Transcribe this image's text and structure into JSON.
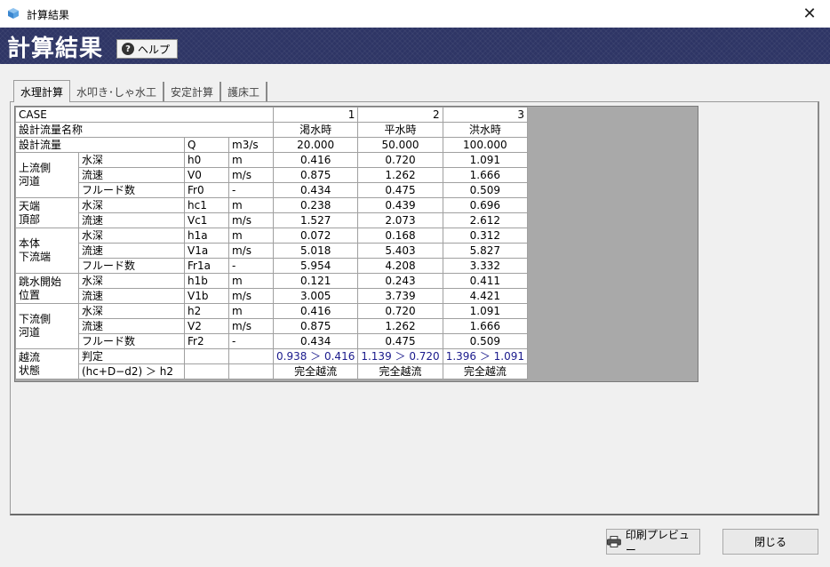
{
  "window": {
    "title": "計算結果",
    "close_glyph": "✕"
  },
  "header": {
    "title": "計算結果",
    "help_label": "ヘルプ"
  },
  "tabs": [
    {
      "label": "水理計算",
      "active": true
    },
    {
      "label": "水叩き･しゃ水工",
      "active": false
    },
    {
      "label": "安定計算",
      "active": false
    },
    {
      "label": "護床工",
      "active": false
    }
  ],
  "table": {
    "case_label": "CASE",
    "cases": [
      "1",
      "2",
      "3"
    ],
    "name_label": "設計流量名称",
    "names": [
      "渇水時",
      "平水時",
      "洪水時"
    ],
    "flow": {
      "label": "設計流量",
      "sym": "Q",
      "unit": "m3/s",
      "values": [
        "20.000",
        "50.000",
        "100.000"
      ]
    },
    "groups": [
      {
        "label": "上流側\n河道",
        "rows": [
          {
            "label": "水深",
            "sym": "h0",
            "unit": "m",
            "values": [
              "0.416",
              "0.720",
              "1.091"
            ]
          },
          {
            "label": "流速",
            "sym": "V0",
            "unit": "m/s",
            "values": [
              "0.875",
              "1.262",
              "1.666"
            ]
          },
          {
            "label": "フルード数",
            "sym": "Fr0",
            "unit": "-",
            "values": [
              "0.434",
              "0.475",
              "0.509"
            ]
          }
        ]
      },
      {
        "label": "天端\n頂部",
        "rows": [
          {
            "label": "水深",
            "sym": "hc1",
            "unit": "m",
            "values": [
              "0.238",
              "0.439",
              "0.696"
            ]
          },
          {
            "label": "流速",
            "sym": "Vc1",
            "unit": "m/s",
            "values": [
              "1.527",
              "2.073",
              "2.612"
            ]
          }
        ]
      },
      {
        "label": "本体\n下流端",
        "rows": [
          {
            "label": "水深",
            "sym": "h1a",
            "unit": "m",
            "values": [
              "0.072",
              "0.168",
              "0.312"
            ]
          },
          {
            "label": "流速",
            "sym": "V1a",
            "unit": "m/s",
            "values": [
              "5.018",
              "5.403",
              "5.827"
            ]
          },
          {
            "label": "フルード数",
            "sym": "Fr1a",
            "unit": "-",
            "values": [
              "5.954",
              "4.208",
              "3.332"
            ]
          }
        ]
      },
      {
        "label": "跳水開始\n位置",
        "rows": [
          {
            "label": "水深",
            "sym": "h1b",
            "unit": "m",
            "values": [
              "0.121",
              "0.243",
              "0.411"
            ]
          },
          {
            "label": "流速",
            "sym": "V1b",
            "unit": "m/s",
            "values": [
              "3.005",
              "3.739",
              "4.421"
            ]
          }
        ]
      },
      {
        "label": "下流側\n河道",
        "rows": [
          {
            "label": "水深",
            "sym": "h2",
            "unit": "m",
            "values": [
              "0.416",
              "0.720",
              "1.091"
            ]
          },
          {
            "label": "流速",
            "sym": "V2",
            "unit": "m/s",
            "values": [
              "0.875",
              "1.262",
              "1.666"
            ]
          },
          {
            "label": "フルード数",
            "sym": "Fr2",
            "unit": "-",
            "values": [
              "0.434",
              "0.475",
              "0.509"
            ]
          }
        ]
      }
    ],
    "overflow": {
      "label": "越流\n状態",
      "judge_label": "判定",
      "cond_label": "(hc+D−d2) ＞ h2",
      "judges": [
        "0.938 ＞ 0.416",
        "1.139 ＞ 0.720",
        "1.396 ＞ 1.091"
      ],
      "results": [
        "完全越流",
        "完全越流",
        "完全越流"
      ]
    }
  },
  "footer": {
    "print_preview_label": "印刷プレビュー",
    "close_label": "閉じる"
  },
  "colors": {
    "header_bg": "#2e3565",
    "judge_text": "#1a1a8c",
    "grid_bg": "#a9a9a9"
  }
}
